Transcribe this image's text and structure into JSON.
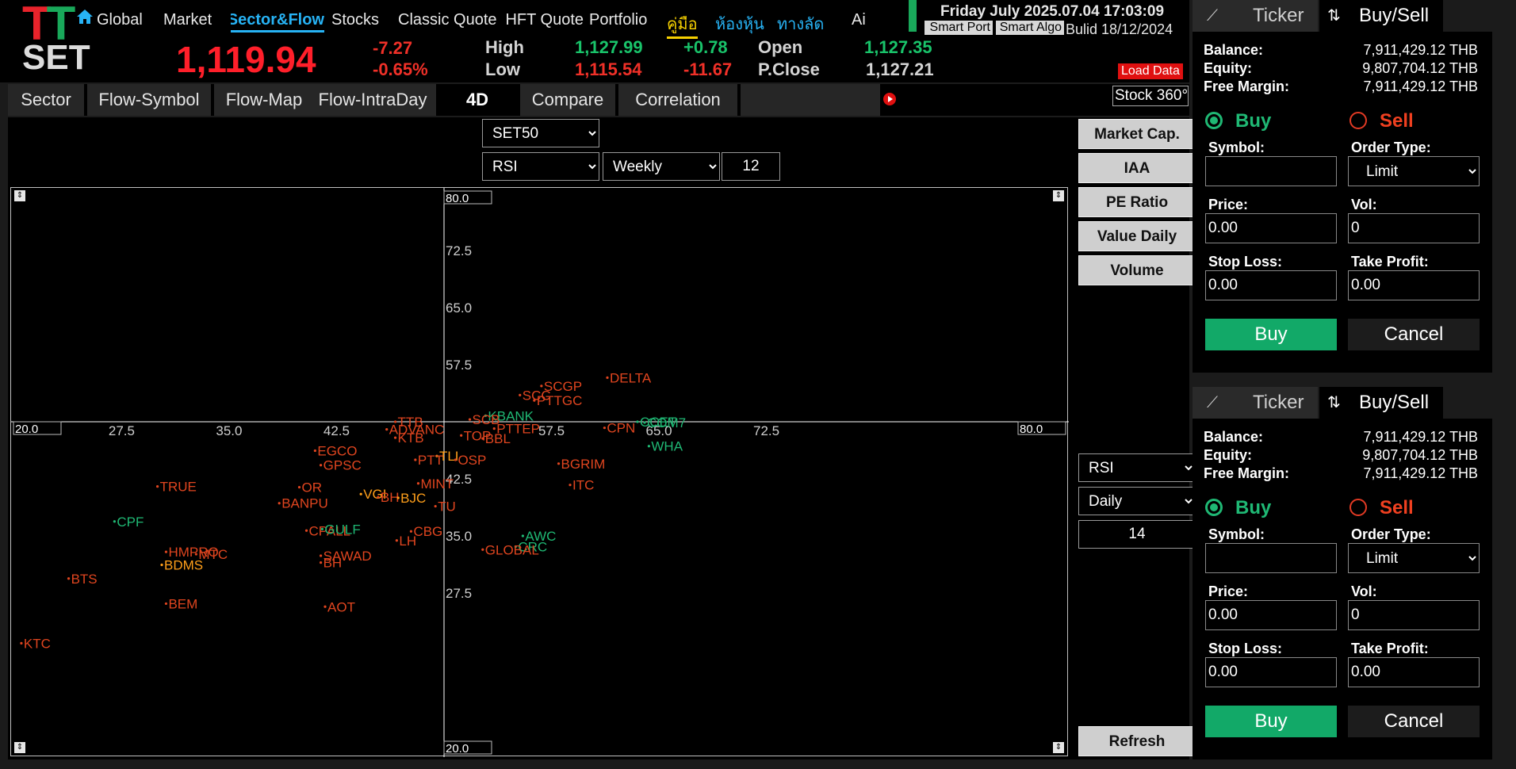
{
  "header": {
    "logo_letters": "TT",
    "market": "SET",
    "index_value": "1,119.94",
    "change": "-7.27",
    "change_pct": "-0.65%",
    "high_label": "High",
    "high_value": "1,127.99",
    "high_diff": "+0.78",
    "low_label": "Low",
    "low_value": "1,115.54",
    "low_diff": "-11.67",
    "open_label": "Open",
    "open_value": "1,127.35",
    "pclose_label": "P.Close",
    "pclose_value": "1,127.21",
    "datetime": "Friday July 2025.07.04 17:03:09",
    "smart_port": "Smart Port",
    "smart_algo": "Smart Algo",
    "build": "Bulid 18/12/2024",
    "load_data": "Load Data",
    "icons": [
      "home-icon"
    ]
  },
  "nav": [
    {
      "label": "Global"
    },
    {
      "label": "Market"
    },
    {
      "label": "Sector&Flow"
    },
    {
      "label": "Stocks"
    },
    {
      "label": "Classic Quote"
    },
    {
      "label": "HFT Quote"
    },
    {
      "label": "Portfolio"
    },
    {
      "label": "คู่มือ"
    },
    {
      "label": "ห้องหุ้น"
    },
    {
      "label": "ทางลัด"
    },
    {
      "label": "Ai"
    }
  ],
  "tabs": [
    {
      "label": "Sector"
    },
    {
      "label": "Flow-Symbol"
    },
    {
      "label": "Flow-Map"
    },
    {
      "label": "Flow-IntraDay"
    },
    {
      "label": "4D"
    },
    {
      "label": "Compare"
    },
    {
      "label": "Correlation"
    }
  ],
  "stock360": "Stock 360°",
  "controls": {
    "index_select": "SET50",
    "indicator_x": "RSI",
    "timeframe_x": "Weekly",
    "period_x": "12",
    "indicator_y": "RSI",
    "timeframe_y": "Daily",
    "period_y": "14",
    "side_buttons": [
      "Market Cap.",
      "IAA",
      "PE Ratio",
      "Value Daily",
      "Volume"
    ],
    "refresh": "Refresh"
  },
  "colors": {
    "red_label": "#e0451f",
    "green_label": "#1fb874",
    "orange_label": "#ff9f1a",
    "axis": "#ffffff"
  },
  "chart_data": {
    "type": "scatter",
    "x_range": [
      20,
      80
    ],
    "y_range": [
      20,
      80
    ],
    "x_ticks": [
      27.5,
      35.0,
      42.5,
      57.5,
      65.0,
      72.5
    ],
    "y_ticks": [
      72.5,
      65.0,
      57.5,
      42.5,
      35.0,
      27.5
    ],
    "x_min_label": "20.0",
    "x_max_label": "80.0",
    "y_max_label": "80.0",
    "y_min_label": "20.0",
    "points": [
      {
        "label": "DELTA",
        "x": 61.4,
        "y": 55.8,
        "color": "red"
      },
      {
        "label": "SCGP",
        "x": 56.8,
        "y": 54.7,
        "color": "red"
      },
      {
        "label": "SCC",
        "x": 55.3,
        "y": 53.5,
        "color": "red"
      },
      {
        "label": "PTTGC",
        "x": 56.3,
        "y": 52.8,
        "color": "red"
      },
      {
        "label": "KBANK",
        "x": 52.9,
        "y": 50.8,
        "color": "green"
      },
      {
        "label": "SCB",
        "x": 51.8,
        "y": 50.3,
        "color": "red"
      },
      {
        "label": "PTTEP",
        "x": 53.5,
        "y": 49.1,
        "color": "red"
      },
      {
        "label": "CPN",
        "x": 61.2,
        "y": 49.2,
        "color": "red"
      },
      {
        "label": "CCET",
        "x": 63.5,
        "y": 50.0,
        "color": "green"
      },
      {
        "label": "COM7",
        "x": 64.0,
        "y": 49.9,
        "color": "green"
      },
      {
        "label": "TTB",
        "x": 46.6,
        "y": 50.0,
        "color": "red"
      },
      {
        "label": "ADVANC",
        "x": 46.0,
        "y": 49.0,
        "color": "red"
      },
      {
        "label": "KTB",
        "x": 46.6,
        "y": 47.9,
        "color": "red"
      },
      {
        "label": "TOP",
        "x": 51.2,
        "y": 48.2,
        "color": "red"
      },
      {
        "label": "BBL",
        "x": 52.7,
        "y": 47.8,
        "color": "red"
      },
      {
        "label": "WHA",
        "x": 64.3,
        "y": 46.8,
        "color": "green"
      },
      {
        "label": "EGCO",
        "x": 41.0,
        "y": 46.2,
        "color": "red"
      },
      {
        "label": "TLI",
        "x": 49.5,
        "y": 45.5,
        "color": "orange"
      },
      {
        "label": "PTT",
        "x": 48.0,
        "y": 45.0,
        "color": "red"
      },
      {
        "label": "OSP",
        "x": 50.8,
        "y": 45.0,
        "color": "red"
      },
      {
        "label": "GPSC",
        "x": 41.4,
        "y": 44.3,
        "color": "red"
      },
      {
        "label": "BGRIM",
        "x": 58.0,
        "y": 44.5,
        "color": "red"
      },
      {
        "label": "ITC",
        "x": 58.8,
        "y": 41.7,
        "color": "red"
      },
      {
        "label": "MINT",
        "x": 48.2,
        "y": 41.9,
        "color": "red"
      },
      {
        "label": "TRUE",
        "x": 30.0,
        "y": 41.5,
        "color": "red"
      },
      {
        "label": "OR",
        "x": 39.9,
        "y": 41.4,
        "color": "red"
      },
      {
        "label": "VGI",
        "x": 44.2,
        "y": 40.5,
        "color": "orange"
      },
      {
        "label": "BH",
        "x": 45.4,
        "y": 40.1,
        "color": "red"
      },
      {
        "label": "BJC",
        "x": 46.8,
        "y": 40.0,
        "color": "orange"
      },
      {
        "label": "BANPU",
        "x": 38.5,
        "y": 39.3,
        "color": "red"
      },
      {
        "label": "TU",
        "x": 49.4,
        "y": 38.9,
        "color": "red"
      },
      {
        "label": "CPF",
        "x": 27.0,
        "y": 36.9,
        "color": "green"
      },
      {
        "label": "CPALL",
        "x": 40.4,
        "y": 35.7,
        "color": "red"
      },
      {
        "label": "GULF",
        "x": 41.5,
        "y": 35.9,
        "color": "green"
      },
      {
        "label": "CBG",
        "x": 47.7,
        "y": 35.6,
        "color": "red"
      },
      {
        "label": "AWC",
        "x": 55.5,
        "y": 35.0,
        "color": "green"
      },
      {
        "label": "LH",
        "x": 46.7,
        "y": 34.4,
        "color": "red"
      },
      {
        "label": "CRC",
        "x": 55.0,
        "y": 33.6,
        "color": "green"
      },
      {
        "label": "GLOBAL",
        "x": 52.7,
        "y": 33.2,
        "color": "red"
      },
      {
        "label": "HMPRO",
        "x": 30.6,
        "y": 32.9,
        "color": "red"
      },
      {
        "label": "MTC",
        "x": 32.7,
        "y": 32.6,
        "color": "red"
      },
      {
        "label": "SAWAD",
        "x": 41.4,
        "y": 32.4,
        "color": "red"
      },
      {
        "label": "BH",
        "x": 41.4,
        "y": 31.5,
        "color": "red"
      },
      {
        "label": "BDMS",
        "x": 30.3,
        "y": 31.2,
        "color": "orange"
      },
      {
        "label": "BTS",
        "x": 23.8,
        "y": 29.4,
        "color": "red"
      },
      {
        "label": "BEM",
        "x": 30.6,
        "y": 26.1,
        "color": "red"
      },
      {
        "label": "AOT",
        "x": 41.7,
        "y": 25.7,
        "color": "red"
      },
      {
        "label": "KTC",
        "x": 20.5,
        "y": 20.9,
        "color": "red"
      }
    ]
  },
  "order_panels": [
    {
      "tab_ticker": "Ticker",
      "tab_buysell": "Buy/Sell",
      "balance_label": "Balance:",
      "balance_value": "7,911,429.12 THB",
      "equity_label": "Equity:",
      "equity_value": "9,807,704.12 THB",
      "freemargin_label": "Free Margin:",
      "freemargin_value": "7,911,429.12 THB",
      "buy_radio": "Buy",
      "sell_radio": "Sell",
      "symbol_label": "Symbol:",
      "symbol_value": "",
      "ordertype_label": "Order Type:",
      "ordertype_value": "Limit",
      "price_label": "Price:",
      "price_value": "0.00",
      "vol_label": "Vol:",
      "vol_value": "0",
      "stoploss_label": "Stop Loss:",
      "stoploss_value": "0.00",
      "takeprofit_label": "Take Profit:",
      "takeprofit_value": "0.00",
      "buy_button": "Buy",
      "cancel_button": "Cancel"
    },
    {
      "tab_ticker": "Ticker",
      "tab_buysell": "Buy/Sell",
      "balance_label": "Balance:",
      "balance_value": "7,911,429.12 THB",
      "equity_label": "Equity:",
      "equity_value": "9,807,704.12 THB",
      "freemargin_label": "Free Margin:",
      "freemargin_value": "7,911,429.12 THB",
      "buy_radio": "Buy",
      "sell_radio": "Sell",
      "symbol_label": "Symbol:",
      "symbol_value": "",
      "ordertype_label": "Order Type:",
      "ordertype_value": "Limit",
      "price_label": "Price:",
      "price_value": "0.00",
      "vol_label": "Vol:",
      "vol_value": "0",
      "stoploss_label": "Stop Loss:",
      "stoploss_value": "0.00",
      "takeprofit_label": "Take Profit:",
      "takeprofit_value": "0.00",
      "buy_button": "Buy",
      "cancel_button": "Cancel"
    }
  ]
}
